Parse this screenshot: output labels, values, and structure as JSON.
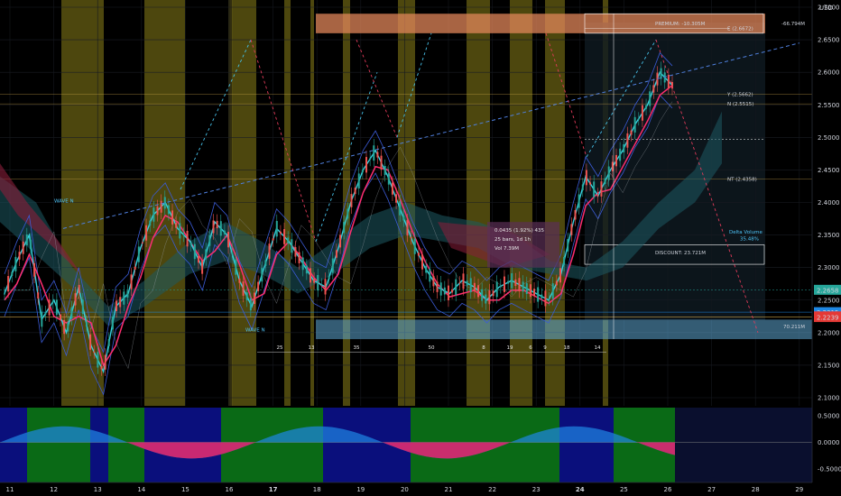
{
  "currency": "USD",
  "chart_data": {
    "type": "line",
    "ylim": [
      2.08,
      2.7
    ],
    "y_ticks": [
      "2.7000",
      "2.6500",
      "2.6000",
      "2.5500",
      "2.5000",
      "2.4500",
      "2.4000",
      "2.3500",
      "2.3000",
      "2.2500",
      "2.2000",
      "2.1500",
      "2.1000"
    ],
    "x_ticks": [
      "11",
      "12",
      "13",
      "14",
      "15",
      "16",
      "17",
      "18",
      "19",
      "20",
      "21",
      "22",
      "23",
      "24",
      "25",
      "26",
      "27",
      "28",
      "29"
    ],
    "bold_x_ticks": [
      "17",
      "24"
    ],
    "price_labels": [
      {
        "text": "2.2658",
        "value": 2.2658,
        "color": "#26a69a"
      },
      {
        "text": "2.2315",
        "value": 2.2315,
        "color": "#1e88e5"
      },
      {
        "text": "2.2250",
        "value": 2.225,
        "color": "#e53935"
      },
      {
        "text": "2.2239",
        "value": 2.2239,
        "color": "#e53935"
      }
    ],
    "levels": [
      {
        "text": "E (2.6672)",
        "value": 2.6672
      },
      {
        "text": "Y (2.5662)",
        "value": 2.5662
      },
      {
        "text": "N (2.5515)",
        "value": 2.5515
      },
      {
        "text": "NT (2.4358)",
        "value": 2.4358
      }
    ],
    "premium_zone": {
      "label": "PREMIUM: -10.305M",
      "volume": "-66.794M",
      "top": 2.69,
      "bottom": 2.66
    },
    "discount_zone": {
      "label": "DISCOUNT: 23.721M",
      "top": 2.335,
      "bottom": 2.305
    },
    "bottom_zone": {
      "label": "70.211M",
      "top": 2.22,
      "bottom": 2.19
    },
    "delta_volume": {
      "title": "Delta Volume",
      "value": "35.48%"
    },
    "info_box": [
      "0.0435 (1.92%) 435",
      "25 bars, 1d 1h",
      "Vol 7.39M"
    ],
    "wave_labels": [
      "WAVE N",
      "WAVE N"
    ],
    "bar_counts": [
      "25",
      "13",
      "35",
      "50",
      "8",
      "19",
      "6",
      "9",
      "18",
      "14"
    ],
    "close_series": [
      2.26,
      2.31,
      2.35,
      2.22,
      2.25,
      2.2,
      2.27,
      2.18,
      2.14,
      2.24,
      2.26,
      2.33,
      2.38,
      2.4,
      2.36,
      2.34,
      2.3,
      2.37,
      2.35,
      2.28,
      2.24,
      2.3,
      2.36,
      2.34,
      2.31,
      2.28,
      2.27,
      2.33,
      2.4,
      2.45,
      2.48,
      2.44,
      2.39,
      2.34,
      2.3,
      2.27,
      2.26,
      2.28,
      2.27,
      2.25,
      2.27,
      2.28,
      2.27,
      2.26,
      2.25,
      2.29,
      2.37,
      2.44,
      2.41,
      2.45,
      2.48,
      2.52,
      2.55,
      2.6,
      2.58
    ],
    "oscillator": {
      "ylim": [
        -0.75,
        0.65
      ],
      "y_ticks": [
        "0.5000",
        "0.0000",
        "-0.5000"
      ]
    }
  }
}
